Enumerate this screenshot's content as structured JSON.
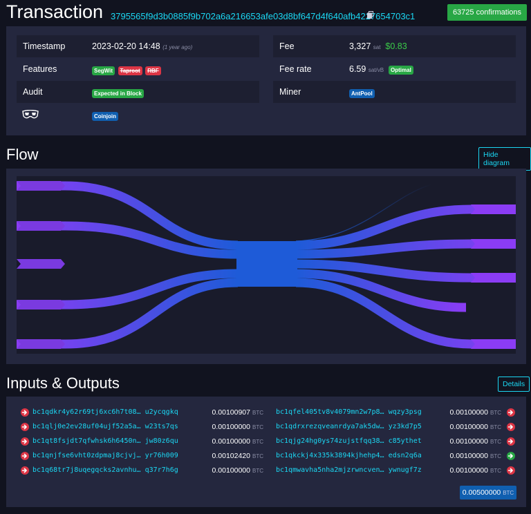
{
  "header": {
    "title": "Transaction",
    "txid": "3795565f9d3b0885f9b702a6a216653afe03d8bf647d4f640afb4227654703c1",
    "confirmations": "63725 confirmations"
  },
  "details": {
    "timestamp_label": "Timestamp",
    "timestamp_value": "2023-02-20 14:48",
    "timestamp_ago": "(1 year ago)",
    "features_label": "Features",
    "features": [
      "SegWit",
      "Taproot",
      "RBF"
    ],
    "audit_label": "Audit",
    "audit_badge": "Expected in Block",
    "coinjoin_badge": "Coinjoin",
    "fee_label": "Fee",
    "fee_sat": "3,327",
    "fee_sat_unit": "sat",
    "fee_usd": "$0.83",
    "feerate_label": "Fee rate",
    "feerate_value": "6.59",
    "feerate_unit": "sat/vB",
    "feerate_badge": "Optimal",
    "miner_label": "Miner",
    "miner_badge": "AntPool"
  },
  "flow": {
    "title": "Flow",
    "hide_button": "Hide diagram",
    "colors": {
      "input": "#7b3ef0",
      "center": "#1e5bd8",
      "output": "#8a3cf0"
    }
  },
  "io": {
    "title": "Inputs & Outputs",
    "details_button": "Details",
    "btc_unit": "BTC",
    "inputs": [
      {
        "addr_start": "bc1qdkr4y62r69tj6xc6h7t08…",
        "addr_end": "u2ycqgkq",
        "amount": "0.00100907"
      },
      {
        "addr_start": "bc1qlj0e2ev28uf04ujf52a5a…",
        "addr_end": "w23ts7qs",
        "amount": "0.00100000"
      },
      {
        "addr_start": "bc1qt8fsjdt7qfwhsk6h6450n…",
        "addr_end": "jw80z6qu",
        "amount": "0.00100000"
      },
      {
        "addr_start": "bc1qnjfse6vht0zdpmaj8cjvj…",
        "addr_end": "yr76h009",
        "amount": "0.00102420"
      },
      {
        "addr_start": "bc1q68tr7j8uqegqcks2avnhu…",
        "addr_end": "q37r7h6g",
        "amount": "0.00100000"
      }
    ],
    "outputs": [
      {
        "addr_start": "bc1qfel405tv8v4079mn2w7p8…",
        "addr_end": "wqzy3psg",
        "amount": "0.00100000",
        "status": "spent"
      },
      {
        "addr_start": "bc1qdrxrezqveanrdya7ak5dw…",
        "addr_end": "yz3kd7p5",
        "amount": "0.00100000",
        "status": "spent"
      },
      {
        "addr_start": "bc1qjg24hg0ys74zujstfqq38…",
        "addr_end": "c85ythet",
        "amount": "0.00100000",
        "status": "spent"
      },
      {
        "addr_start": "bc1qkckj4x335k3894kjhehp4…",
        "addr_end": "edsn2q6a",
        "amount": "0.00100000",
        "status": "unspent"
      },
      {
        "addr_start": "bc1qmwavha5nha2mjzrwncven…",
        "addr_end": "ywnugf7z",
        "amount": "0.00100000",
        "status": "spent"
      }
    ],
    "total": "0.00500000"
  }
}
